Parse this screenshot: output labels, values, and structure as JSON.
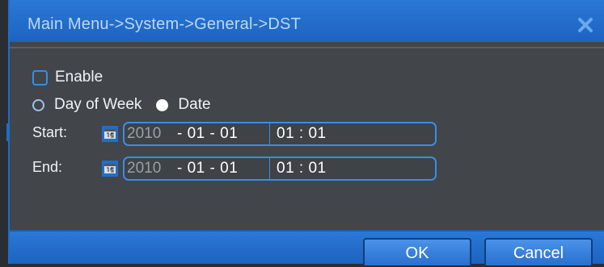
{
  "window": {
    "title": "Main Menu->System->General->DST"
  },
  "icons": {
    "close": "close-icon",
    "calendar": "calendar-icon"
  },
  "form": {
    "enable_label": "Enable",
    "enable_checked": false,
    "mode_options": [
      {
        "label": "Day of Week",
        "selected": false
      },
      {
        "label": "Date",
        "selected": true
      }
    ],
    "start": {
      "label": "Start:",
      "year": "2010",
      "month_day": "- 01 - 01",
      "time": "01 : 01"
    },
    "end": {
      "label": "End:",
      "year": "2010",
      "month_day": "- 01 - 01",
      "time": "01 : 01"
    }
  },
  "buttons": {
    "ok": "OK",
    "cancel": "Cancel"
  },
  "colors": {
    "titlebar": "#2b78d6",
    "accent": "#3a8de6",
    "panel": "#424549"
  }
}
